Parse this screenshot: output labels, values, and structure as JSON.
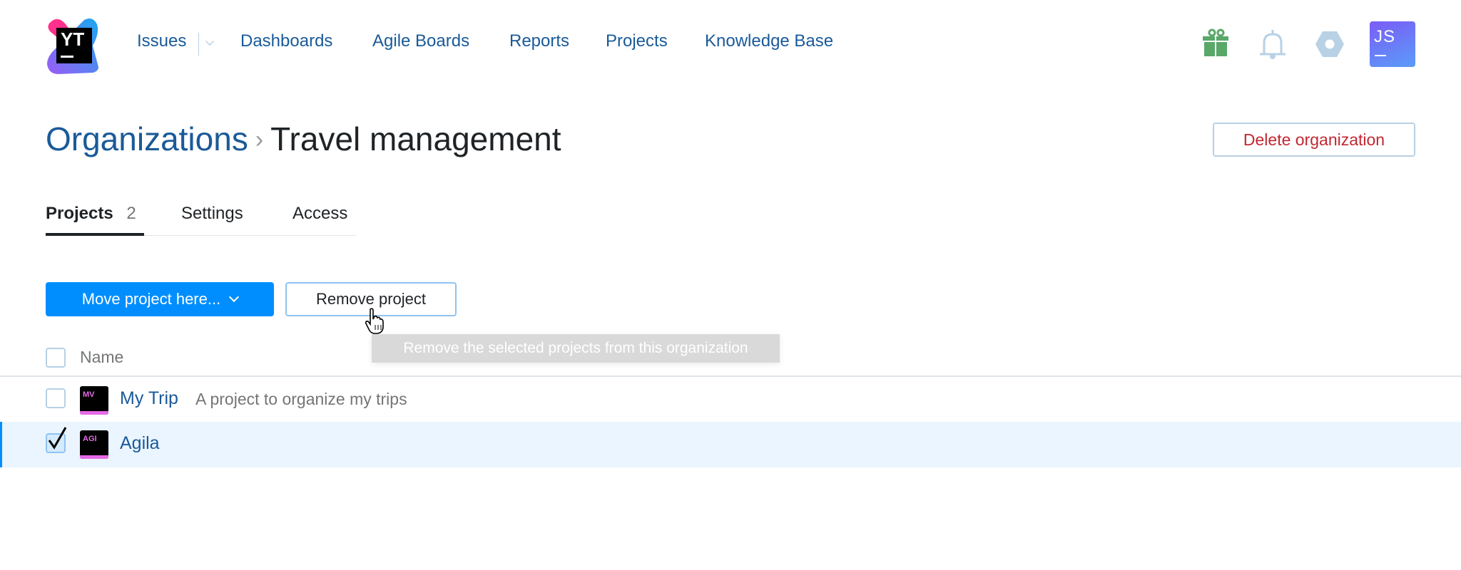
{
  "header": {
    "logo_text": "YT",
    "nav": [
      "Issues",
      "Dashboards",
      "Agile Boards",
      "Reports",
      "Projects",
      "Knowledge Base"
    ],
    "avatar_initials": "JS"
  },
  "page": {
    "breadcrumb_parent": "Organizations",
    "breadcrumb_separator": "›",
    "title": "Travel management",
    "delete_label": "Delete organization"
  },
  "tabs": [
    {
      "label": "Projects",
      "count": "2"
    },
    {
      "label": "Settings"
    },
    {
      "label": "Access"
    }
  ],
  "toolbar": {
    "move_label": "Move project here...",
    "remove_label": "Remove project",
    "tooltip": "Remove the selected projects from this organization"
  },
  "table": {
    "header_name": "Name",
    "rows": [
      {
        "icon": "MV",
        "name": "My Trip",
        "description": "A project to organize my trips",
        "checked": false
      },
      {
        "icon": "AGI",
        "name": "Agila",
        "description": "",
        "checked": true
      }
    ]
  },
  "colors": {
    "accent": "#008eff",
    "link": "#1a5a99",
    "danger": "#c22731",
    "selected_row": "#ebf5ff"
  }
}
